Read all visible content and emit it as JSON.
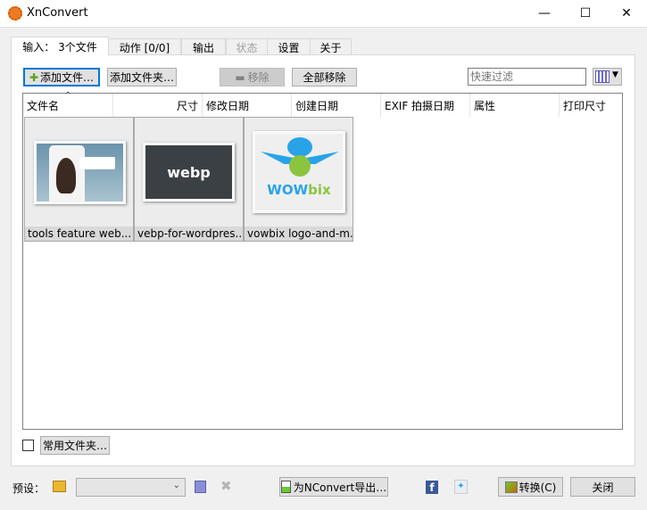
{
  "window": {
    "title": "XnConvert",
    "minimize": "—",
    "maximize": "☐",
    "close": "✕"
  },
  "tabs": [
    {
      "label": "输入： 3个文件"
    },
    {
      "label": "动作 [0/0]"
    },
    {
      "label": "输出"
    },
    {
      "label": "状态"
    },
    {
      "label": "设置"
    },
    {
      "label": "关于"
    }
  ],
  "toolbar": {
    "add_files": "添加文件…",
    "add_folder": "添加文件夹…",
    "remove": "移除",
    "remove_all": "全部移除",
    "filter_placeholder": "快速过滤"
  },
  "columns": [
    "文件名",
    "尺寸",
    "修改日期",
    "创建日期",
    "EXIF 拍摄日期",
    "属性",
    "打印尺寸"
  ],
  "files": [
    {
      "name": "tools feature web..."
    },
    {
      "name": "vebp-for-wordpres..."
    },
    {
      "name": "vowbix logo-and-m..."
    }
  ],
  "thumb_text": {
    "webp": "webp",
    "wow": "WOW",
    "bix": "bix"
  },
  "favorites": {
    "label": "常用文件夹…"
  },
  "bottom": {
    "preset_label": "预设：",
    "export": "为NConvert导出…",
    "convert": "转换(C)",
    "close": "关闭"
  }
}
